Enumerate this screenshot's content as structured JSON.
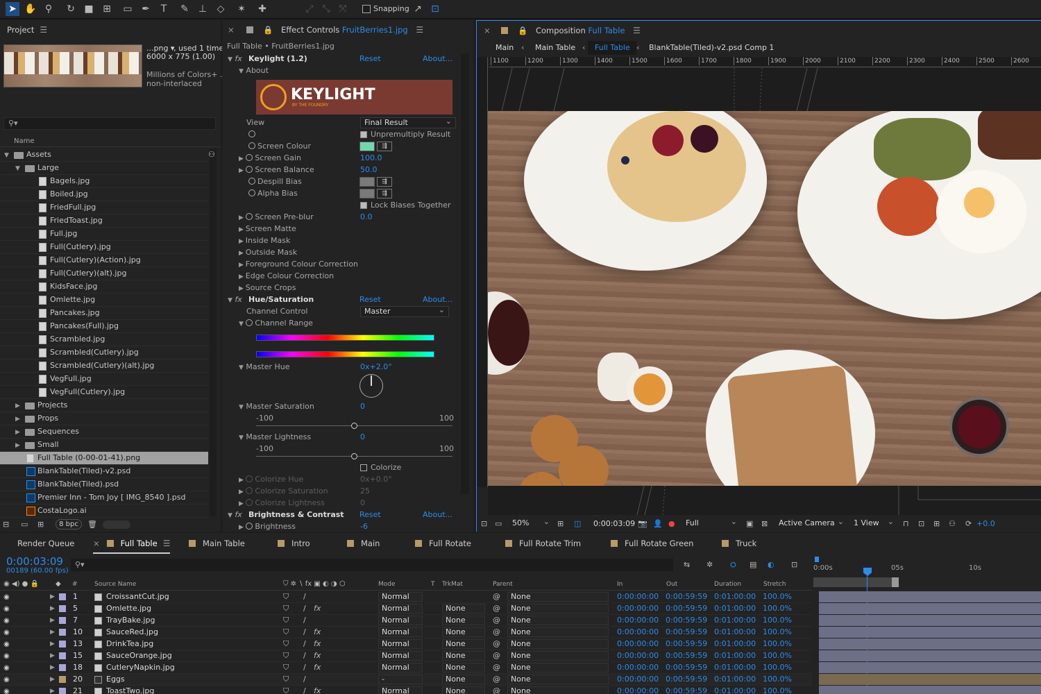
{
  "toolbar": {
    "snapping_label": "Snapping"
  },
  "project": {
    "title": "Project",
    "thumb_name": "...png ▾",
    "thumb_used": ", used 1 time",
    "thumb_dims": "6000 x 775 (1.00)",
    "thumb_colors": "Millions of Colors+ ...",
    "thumb_interlace": "non-interlaced",
    "col_name": "Name",
    "bpc": "8 bpc",
    "items": [
      {
        "label": "Assets",
        "type": "folder",
        "level": 0,
        "open": true
      },
      {
        "label": "Large",
        "type": "folder",
        "level": 1,
        "open": true
      },
      {
        "label": "Bagels.jpg",
        "type": "file",
        "level": 2
      },
      {
        "label": "Boiled.jpg",
        "type": "file",
        "level": 2
      },
      {
        "label": "FriedFull.jpg",
        "type": "file",
        "level": 2
      },
      {
        "label": "FriedToast.jpg",
        "type": "file",
        "level": 2
      },
      {
        "label": "Full.jpg",
        "type": "file",
        "level": 2
      },
      {
        "label": "Full(Cutlery).jpg",
        "type": "file",
        "level": 2
      },
      {
        "label": "Full(Cutlery)(Action).jpg",
        "type": "file",
        "level": 2
      },
      {
        "label": "Full(Cutlery)(alt).jpg",
        "type": "file",
        "level": 2
      },
      {
        "label": "KidsFace.jpg",
        "type": "file",
        "level": 2
      },
      {
        "label": "Omlette.jpg",
        "type": "file",
        "level": 2
      },
      {
        "label": "Pancakes.jpg",
        "type": "file",
        "level": 2
      },
      {
        "label": "Pancakes(Full).jpg",
        "type": "file",
        "level": 2
      },
      {
        "label": "Scrambled.jpg",
        "type": "file",
        "level": 2
      },
      {
        "label": "Scrambled(Cutlery).jpg",
        "type": "file",
        "level": 2
      },
      {
        "label": "Scrambled(Cutlery)(alt).jpg",
        "type": "file",
        "level": 2
      },
      {
        "label": "VegFull.jpg",
        "type": "file",
        "level": 2
      },
      {
        "label": "VegFull(Cutlery).jpg",
        "type": "file",
        "level": 2
      },
      {
        "label": "Projects",
        "type": "folder",
        "level": 1,
        "open": false
      },
      {
        "label": "Props",
        "type": "folder",
        "level": 1,
        "open": false
      },
      {
        "label": "Sequences",
        "type": "folder",
        "level": 1,
        "open": false
      },
      {
        "label": "Small",
        "type": "folder",
        "level": 1,
        "open": false
      },
      {
        "label": "Full Table (0-00-01-41).png",
        "type": "file",
        "level": 1,
        "selected": true
      },
      {
        "label": "BlankTable(Tiled)-v2.psd",
        "type": "ps",
        "level": 1
      },
      {
        "label": "BlankTable(Tiled).psd",
        "type": "ps",
        "level": 1
      },
      {
        "label": "Premier Inn - Tom Joy [ IMG_8540 ].psd",
        "type": "ps",
        "level": 1
      },
      {
        "label": "CostaLogo.ai",
        "type": "ai",
        "level": 1
      }
    ]
  },
  "effects": {
    "tab_prefix": "Effect Controls",
    "tab_file": "FruitBerries1.jpg",
    "sub": "Full Table • FruitBerries1.jpg",
    "reset": "Reset",
    "about": "About...",
    "keylight": {
      "name": "Keylight (1.2)",
      "about_group": "About",
      "logo": "KEYLIGHT",
      "logo_sub": "BY THE FOUNDRY",
      "view_label": "View",
      "view_value": "Final Result",
      "unpremult": "Unpremultiply Result",
      "screen_colour": "Screen Colour",
      "screen_gain": "Screen Gain",
      "screen_gain_val": "100.0",
      "screen_balance": "Screen Balance",
      "screen_balance_val": "50.0",
      "despill": "Despill Bias",
      "alpha_bias": "Alpha Bias",
      "lock": "Lock Biases Together",
      "preblur": "Screen Pre-blur",
      "preblur_val": "0.0",
      "groups": [
        "Screen Matte",
        "Inside Mask",
        "Outside Mask",
        "Foreground Colour Correction",
        "Edge Colour Correction",
        "Source Crops"
      ]
    },
    "hue": {
      "name": "Hue/Saturation",
      "channel_control": "Channel Control",
      "channel_value": "Master",
      "channel_range": "Channel Range",
      "master_hue": "Master Hue",
      "master_hue_val": "0x+2.0°",
      "master_sat": "Master Saturation",
      "master_sat_val": "0",
      "min": "-100",
      "max": "100",
      "master_light": "Master Lightness",
      "master_light_val": "0",
      "colorize": "Colorize",
      "colorize_hue": "Colorize Hue",
      "colorize_hue_val": "0x+0.0°",
      "colorize_sat": "Colorize Saturation",
      "colorize_sat_val": "25",
      "colorize_light": "Colorize Lightness",
      "colorize_light_val": "0"
    },
    "bc": {
      "name": "Brightness & Contrast",
      "brightness": "Brightness",
      "brightness_val": "-6"
    }
  },
  "comp": {
    "tab_prefix": "Composition",
    "tab_name": "Full Table",
    "crumbs": [
      "Main",
      "Main Table",
      "Full Table",
      "BlankTable(Tiled)-v2.psd Comp 1"
    ],
    "ruler": [
      "1100",
      "1200",
      "1300",
      "1400",
      "1500",
      "1600",
      "1700",
      "1800",
      "1900",
      "2000",
      "2100",
      "2200",
      "2300",
      "2400",
      "2500",
      "2600"
    ],
    "zoom": "50%",
    "time": "0:00:03:09",
    "resolution": "Full",
    "camera": "Active Camera",
    "views": "1 View",
    "exposure": "+0.0"
  },
  "timeline": {
    "tabs": [
      {
        "label": "Render Queue",
        "color": ""
      },
      {
        "label": "Full Table",
        "color": "#b69a6a",
        "active": true
      },
      {
        "label": "Main Table",
        "color": "#b69a6a"
      },
      {
        "label": "Intro",
        "color": "#b69a6a"
      },
      {
        "label": "Main",
        "color": "#b69a6a"
      },
      {
        "label": "Full Rotate",
        "color": "#b69a6a"
      },
      {
        "label": "Full Rotate Trim",
        "color": "#b69a6a"
      },
      {
        "label": "Full Rotate Green",
        "color": "#b69a6a"
      },
      {
        "label": "Truck",
        "color": "#b69a6a"
      }
    ],
    "timecode": "0:00:03:09",
    "frames": "00189 (60.00 fps)",
    "headers": {
      "num": "#",
      "source": "Source Name",
      "mode": "Mode",
      "t": "T",
      "trkmat": "TrkMat",
      "parent": "Parent",
      "in": "In",
      "out": "Out",
      "duration": "Duration",
      "stretch": "Stretch"
    },
    "ruler": [
      "0:00s",
      "05s",
      "10s"
    ],
    "layers": [
      {
        "num": "1",
        "name": "CroissantCut.jpg",
        "mode": "Normal",
        "trkmat": "",
        "parent": "None",
        "in": "0:00:00:00",
        "out": "0:00:59:59",
        "dur": "0:01:00:00",
        "stretch": "100.0%",
        "fx": false,
        "color": "#a9a7d8"
      },
      {
        "num": "5",
        "name": "Omlette.jpg",
        "mode": "Normal",
        "trkmat": "None",
        "parent": "None",
        "in": "0:00:00:00",
        "out": "0:00:59:59",
        "dur": "0:01:00:00",
        "stretch": "100.0%",
        "fx": true,
        "color": "#a9a7d8"
      },
      {
        "num": "7",
        "name": "TrayBake.jpg",
        "mode": "Normal",
        "trkmat": "None",
        "parent": "None",
        "in": "0:00:00:00",
        "out": "0:00:59:59",
        "dur": "0:01:00:00",
        "stretch": "100.0%",
        "fx": false,
        "color": "#a9a7d8"
      },
      {
        "num": "10",
        "name": "SauceRed.jpg",
        "mode": "Normal",
        "trkmat": "None",
        "parent": "None",
        "in": "0:00:00:00",
        "out": "0:00:59:59",
        "dur": "0:01:00:00",
        "stretch": "100.0%",
        "fx": true,
        "color": "#a9a7d8"
      },
      {
        "num": "13",
        "name": "DrinkTea.jpg",
        "mode": "Normal",
        "trkmat": "None",
        "parent": "None",
        "in": "0:00:00:00",
        "out": "0:00:59:59",
        "dur": "0:01:00:00",
        "stretch": "100.0%",
        "fx": true,
        "color": "#a9a7d8"
      },
      {
        "num": "15",
        "name": "SauceOrange.jpg",
        "mode": "Normal",
        "trkmat": "None",
        "parent": "None",
        "in": "0:00:00:00",
        "out": "0:00:59:59",
        "dur": "0:01:00:00",
        "stretch": "100.0%",
        "fx": true,
        "color": "#a9a7d8"
      },
      {
        "num": "18",
        "name": "CutleryNapkin.jpg",
        "mode": "Normal",
        "trkmat": "None",
        "parent": "None",
        "in": "0:00:00:00",
        "out": "0:00:59:59",
        "dur": "0:01:00:00",
        "stretch": "100.0%",
        "fx": true,
        "color": "#a9a7d8"
      },
      {
        "num": "20",
        "name": "Eggs",
        "mode": "-",
        "trkmat": "None",
        "parent": "None",
        "in": "0:00:00:00",
        "out": "0:00:59:59",
        "dur": "0:01:00:00",
        "stretch": "100.0%",
        "fx": false,
        "color": "#b69a6a"
      },
      {
        "num": "21",
        "name": "ToastTwo.jpg",
        "mode": "Normal",
        "trkmat": "None",
        "parent": "None",
        "in": "0:00:00:00",
        "out": "0:00:59:59",
        "dur": "0:01:00:00",
        "stretch": "100.0%",
        "fx": true,
        "color": "#a9a7d8"
      }
    ]
  },
  "colors": {
    "accent": "#2d8ceb",
    "panel": "#232323",
    "table": "#8a6a55",
    "track": "#6d6f86",
    "screen_colour": "#74d6ad"
  }
}
